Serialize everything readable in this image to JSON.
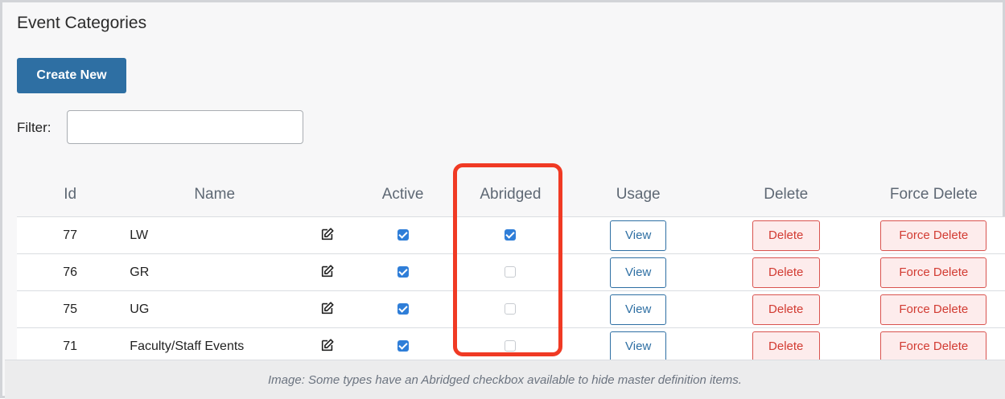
{
  "page": {
    "title": "Event Categories",
    "create_button": "Create New",
    "filter_label": "Filter:",
    "filter_value": ""
  },
  "table": {
    "headers": {
      "id": "Id",
      "name": "Name",
      "active": "Active",
      "abridged": "Abridged",
      "usage": "Usage",
      "delete": "Delete",
      "force_delete": "Force Delete"
    },
    "rows": [
      {
        "id": "77",
        "name": "LW",
        "active": true,
        "abridged": true,
        "view": "View",
        "delete": "Delete",
        "force_delete": "Force Delete"
      },
      {
        "id": "76",
        "name": "GR",
        "active": true,
        "abridged": false,
        "view": "View",
        "delete": "Delete",
        "force_delete": "Force Delete"
      },
      {
        "id": "75",
        "name": "UG",
        "active": true,
        "abridged": false,
        "view": "View",
        "delete": "Delete",
        "force_delete": "Force Delete"
      },
      {
        "id": "71",
        "name": "Faculty/Staff Events",
        "active": true,
        "abridged": false,
        "view": "View",
        "delete": "Delete",
        "force_delete": "Force Delete"
      }
    ]
  },
  "caption": "Image: Some types have an Abridged checkbox available to hide master definition items.",
  "colors": {
    "primary": "#2e6fa3",
    "danger": "#d9534f",
    "danger_bg": "#fdecec",
    "checkbox": "#2f7ed8",
    "highlight": "#f03a24"
  },
  "icons": {
    "edit": "edit-icon",
    "checked": "checkbox-checked-icon",
    "unchecked": "checkbox-unchecked-icon"
  }
}
